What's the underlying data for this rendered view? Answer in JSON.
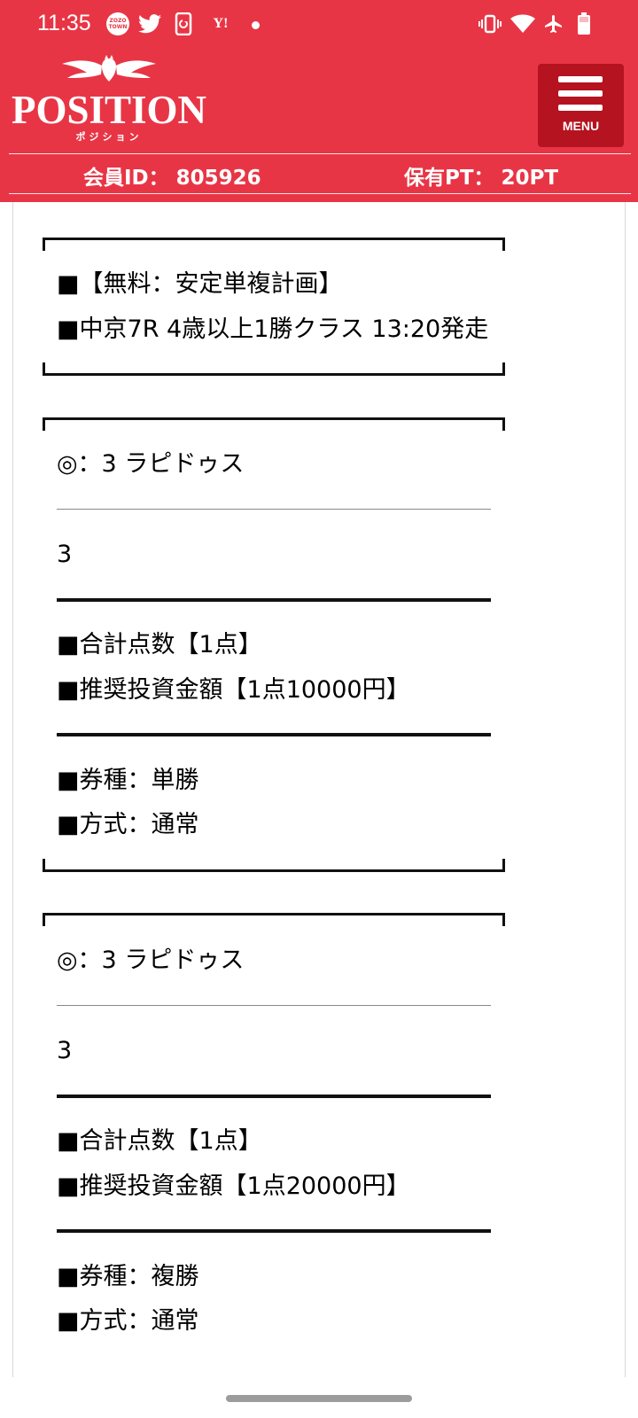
{
  "status_bar": {
    "time": "11:35",
    "icons": [
      "zozotown-icon",
      "twitter-icon",
      "phone-sync-icon",
      "yahoo-icon",
      "dot-icon",
      "vibrate-icon",
      "wifi-icon",
      "airplane-icon",
      "battery-icon"
    ],
    "zozo_line1": "ZOZO",
    "zozo_line2": "TOWN",
    "yahoo_text": "Y!"
  },
  "header": {
    "logo_text": "POSITION",
    "logo_sub": "ポジション",
    "menu_label": "MENU",
    "member_id": "会員ID： 805926",
    "points": "保有PT： 20PT",
    "colors": {
      "background": "#e83545",
      "menu_button": "#b5131f"
    }
  },
  "intro_box": {
    "line1": "■【無料：安定単複計画】",
    "line2": "■中京7R 4歳以上1勝クラス 13:20発走"
  },
  "picks": [
    {
      "horse": "◎：3 ラピドゥス",
      "number": "3",
      "total_points": "■合計点数【1点】",
      "investment": "■推奨投資金額【1点10000円】",
      "ticket_type": "■券種：単勝",
      "method": "■方式：通常"
    },
    {
      "horse": "◎：3 ラピドゥス",
      "number": "3",
      "total_points": "■合計点数【1点】",
      "investment": "■推奨投資金額【1点20000円】",
      "ticket_type": "■券種：複勝",
      "method": "■方式：通常"
    }
  ]
}
